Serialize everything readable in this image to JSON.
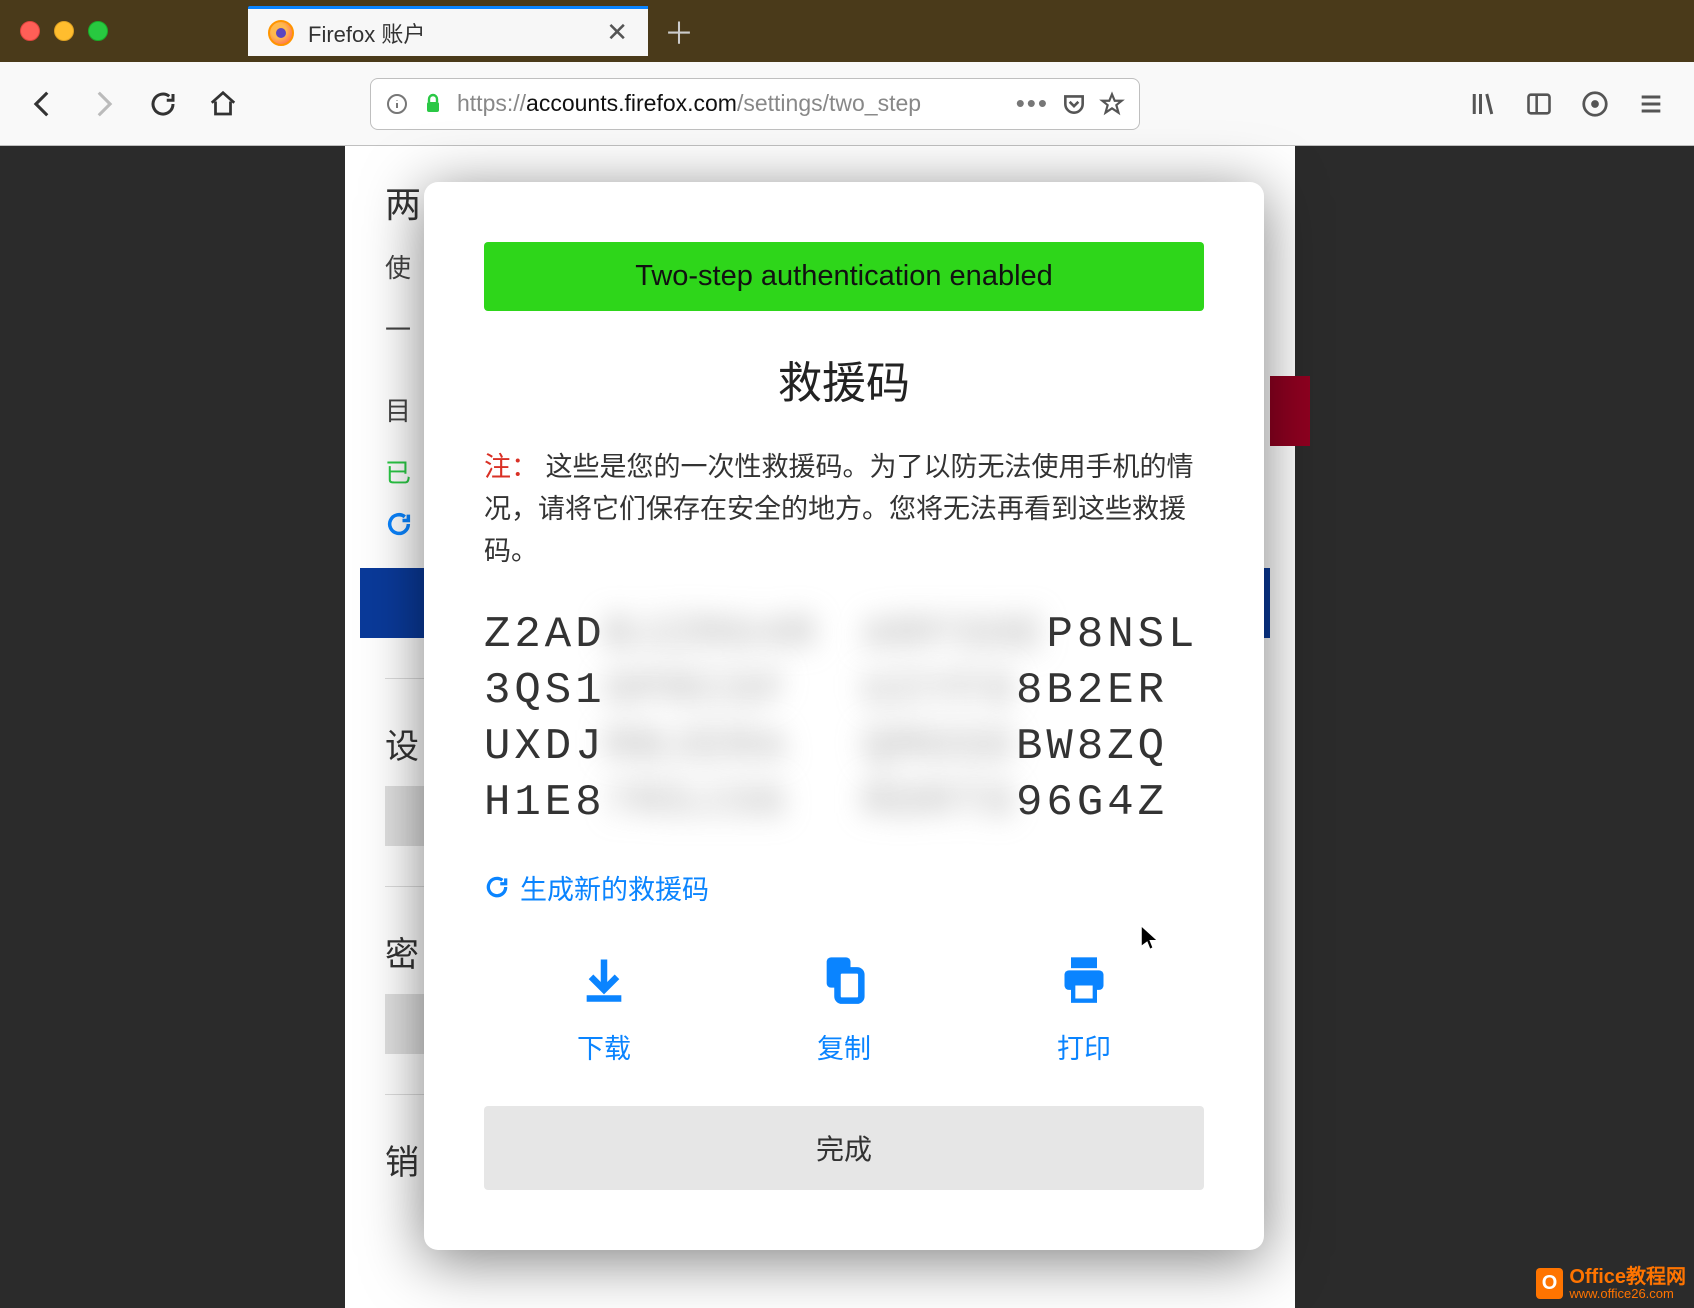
{
  "browser": {
    "tab_title": "Firefox 账户",
    "url_scheme": "https://",
    "url_host": "accounts.firefox.com",
    "url_path": "/settings/two_step"
  },
  "background": {
    "section1_heading": "两",
    "section1_text1": "使",
    "section1_text2": "一",
    "section1_status_label": "目",
    "section1_status_value": "已",
    "section2_heading": "设",
    "section3_heading": "密",
    "section4_heading": "销"
  },
  "modal": {
    "banner": "Two-step authentication enabled",
    "title": "救援码",
    "note_label": "注：",
    "note_text": "这些是您的一次性救援码。为了以防无法使用手机的情况，请将它们保存在安全的地方。您将无法再看到这些救援码。",
    "codes": [
      {
        "prefix": "Z2AD",
        "blur": "BJZR64R",
        "suffix": ""
      },
      {
        "prefix": "",
        "blur": "ARFSOE",
        "suffix": "P8NSL"
      },
      {
        "prefix": "3QS1",
        "blur": "OPRCSF",
        "suffix": ""
      },
      {
        "prefix": "",
        "blur": "U2YF8",
        "suffix": "8B2ER"
      },
      {
        "prefix": "UXDJ",
        "blur": "RBJERA",
        "suffix": ""
      },
      {
        "prefix": "",
        "blur": "QMOSD",
        "suffix": "BW8ZQ"
      },
      {
        "prefix": "H1E8",
        "blur": "7RSJ36",
        "suffix": ""
      },
      {
        "prefix": "",
        "blur": "RDRT8",
        "suffix": "96G4Z"
      }
    ],
    "regenerate_link": "生成新的救援码",
    "action_download": "下载",
    "action_copy": "复制",
    "action_print": "打印",
    "done_button": "完成"
  },
  "watermark": {
    "brand": "Office教程网",
    "url": "www.office26.com"
  }
}
